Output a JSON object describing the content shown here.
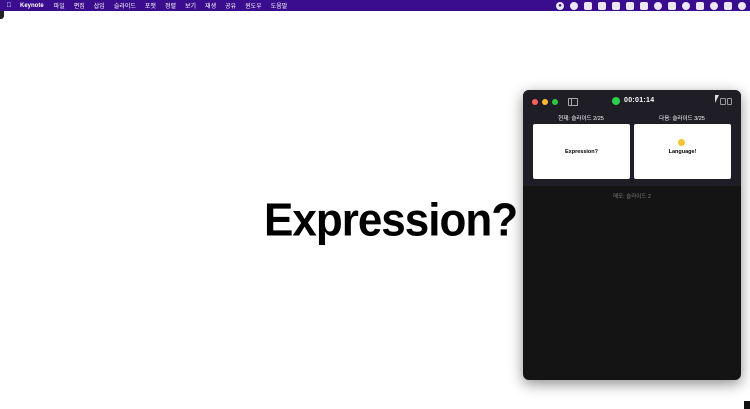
{
  "menubar": {
    "app_name": "Keynote",
    "items": [
      "파일",
      "편집",
      "삽입",
      "슬라이드",
      "포맷",
      "정렬",
      "보기",
      "재생",
      "공유",
      "윈도우",
      "도움말"
    ]
  },
  "slide": {
    "title": "Expression?"
  },
  "presenter": {
    "timer": "00:01:14",
    "current_label": "현재: 슬라이드 2/25",
    "next_label": "다음: 슬라이드 3/25",
    "current_thumb_text": "Expression?",
    "next_thumb_text": "Language!",
    "notes_label": "메모: 슬라이드 2"
  },
  "colors": {
    "menubar_bg": "#3a0d8f",
    "timer_green": "#2bd04a",
    "sun_yellow": "#f7c531"
  }
}
